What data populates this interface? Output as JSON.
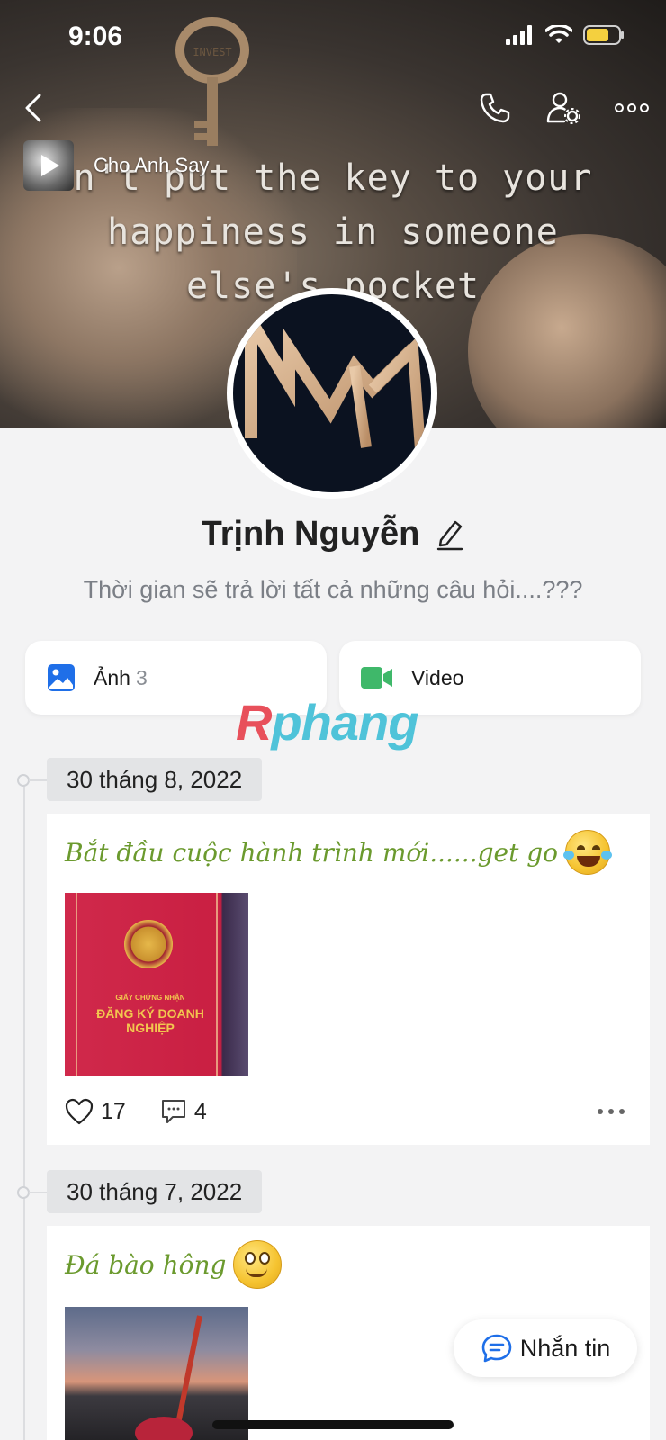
{
  "status": {
    "time": "9:06"
  },
  "cover": {
    "quote_lines": [
      "n't put the key to your",
      "happiness in someone",
      "else's pocket"
    ],
    "key_text": "INVEST"
  },
  "music": {
    "title": "Cho Anh Say"
  },
  "profile": {
    "name": "Trịnh Nguyễn",
    "bio": "Thời gian sẽ trả lời tất cả những câu hỏi....???"
  },
  "tiles": [
    {
      "label": "Ảnh",
      "count": "3",
      "icon": "photo-icon"
    },
    {
      "label": "Video",
      "icon": "video-icon"
    }
  ],
  "watermark": {
    "first": "R",
    "rest": "phang"
  },
  "posts": [
    {
      "date": "30 tháng 8, 2022",
      "text": "Bắt đầu cuộc hành trình mới......get go",
      "emoji": "laughing-tears-emoji",
      "image_caption_small": "GIẤY CHỨNG NHẬN",
      "image_caption_big": "ĐĂNG KÝ DOANH NGHIỆP",
      "likes": "17",
      "comments": "4"
    },
    {
      "date": "30 tháng 7, 2022",
      "text": "Đá bào hông",
      "emoji": "smiling-face-emoji"
    }
  ],
  "message_button": {
    "label": "Nhắn tin"
  },
  "colors": {
    "post_text": "#6b9a2e",
    "accent_blue": "#1f6fe8",
    "video_green": "#3fb86a"
  }
}
